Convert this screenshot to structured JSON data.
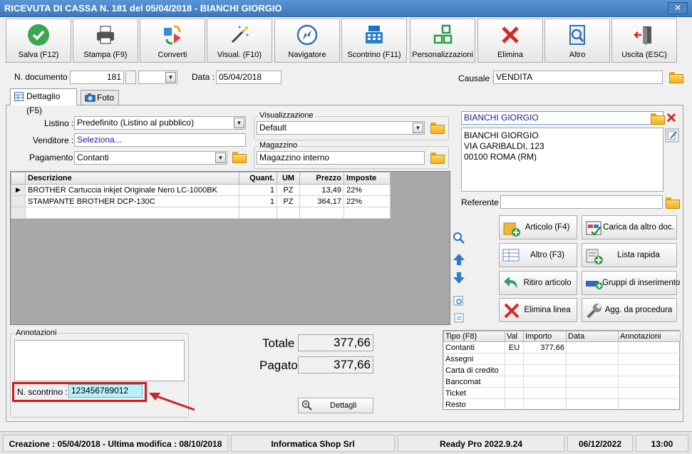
{
  "window": {
    "title": "RICEVUTA DI CASSA N. 181 del 05/04/2018 - BIANCHI GIORGIO",
    "close_glyph": "✕"
  },
  "toolbar": [
    {
      "label": "Salva (F12)",
      "icon": "save-check-icon"
    },
    {
      "label": "Stampa (F9)",
      "icon": "printer-icon"
    },
    {
      "label": "Converti",
      "icon": "convert-icon"
    },
    {
      "label": "Visual. (F10)",
      "icon": "magic-wand-icon"
    },
    {
      "label": "Navigatore",
      "icon": "compass-icon"
    },
    {
      "label": "Scontrino (F11)",
      "icon": "cash-register-icon"
    },
    {
      "label": "Personalizzazioni",
      "icon": "customize-icon"
    },
    {
      "label": "Elimina",
      "icon": "delete-x-icon"
    },
    {
      "label": "Altro",
      "icon": "search-document-icon"
    },
    {
      "label": "Uscita (ESC)",
      "icon": "exit-door-icon"
    }
  ],
  "header": {
    "doc_number_label": "N. documento :",
    "doc_number": "181",
    "date_label": "Data :",
    "date": "05/04/2018",
    "causale_label": "Causale :",
    "causale": "VENDITA"
  },
  "tabs": [
    {
      "label": "Dettaglio (F5)"
    },
    {
      "label": "Foto"
    }
  ],
  "form": {
    "listino_label": "Listino :",
    "listino": "Predefinito (Listino al pubblico)",
    "venditore_label": "Venditore :",
    "venditore": "Seleziona...",
    "pagamento_label": "Pagamento :",
    "pagamento": "Contanti",
    "visualizzazione_title": "Visualizzazione",
    "visualizzazione": "Default",
    "magazzino_title": "Magazzino",
    "magazzino": "Magazzino interno"
  },
  "grid": {
    "columns": [
      "Descrizione",
      "Quant.",
      "UM",
      "Prezzo",
      "Imposte"
    ],
    "rows": [
      [
        "BROTHER Cartuccia inkjet Originale Nero LC-1000BK",
        "1",
        "PZ",
        "13,49",
        "22%"
      ],
      [
        "STAMPANTE BROTHER DCP-130C",
        "1",
        "PZ",
        "364,17",
        "22%"
      ]
    ]
  },
  "customer": {
    "name": "BIANCHI GIORGIO",
    "address_lines": [
      "BIANCHI GIORGIO",
      "VIA GARIBALDI, 123",
      "00100 ROMA (RM)"
    ],
    "referente_label": "Referente"
  },
  "actions": [
    {
      "label": "Articolo (F4)",
      "icon": "add-article-icon"
    },
    {
      "label": "Carica da altro doc.",
      "icon": "load-document-icon"
    },
    {
      "label": "Altro (F3)",
      "icon": "other-table-icon"
    },
    {
      "label": "Lista rapida",
      "icon": "quick-list-icon"
    },
    {
      "label": "Ritiro articolo",
      "icon": "return-arrow-icon"
    },
    {
      "label": "Gruppi di inserimento",
      "icon": "insert-group-icon"
    },
    {
      "label": "Elimina linea",
      "icon": "delete-line-icon"
    },
    {
      "label": "Agg. da procedura",
      "icon": "wrench-icon"
    }
  ],
  "annotazioni": {
    "title": "Annotazioni",
    "scontrino_label": "N. scontrino :",
    "scontrino": "123456789012"
  },
  "totals": {
    "totale_label": "Totale",
    "totale": "377,66",
    "pagato_label": "Pagato",
    "pagato": "377,66",
    "dettagli_label": "Dettagli"
  },
  "payments": {
    "columns": [
      "Tipo (F8)",
      "Val",
      "Importo",
      "Data",
      "Annotazioni"
    ],
    "rows": [
      {
        "tipo": "Contanti",
        "val": "EU",
        "importo": "377,66"
      },
      {
        "tipo": "Assegni",
        "val": "",
        "importo": ""
      },
      {
        "tipo": "Carta di credito",
        "val": "",
        "importo": ""
      },
      {
        "tipo": "Bancomat",
        "val": "",
        "importo": ""
      },
      {
        "tipo": "Ticket",
        "val": "",
        "importo": ""
      },
      {
        "tipo": "Resto",
        "val": "",
        "importo": ""
      }
    ]
  },
  "status": {
    "dates": "Creazione : 05/04/2018 - Ultima modifica : 08/10/2018",
    "company": "Informatica Shop Srl",
    "version": "Ready Pro 2022.9.24",
    "date": "06/12/2022",
    "time": "13:00"
  },
  "colors": {
    "highlight": "#d11a1a",
    "scontrino_bg": "#b9f1f8",
    "title_bar": "#4a88cc"
  }
}
